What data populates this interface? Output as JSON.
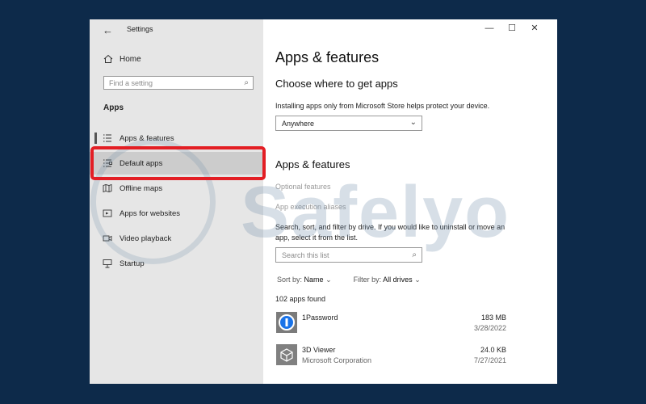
{
  "window": {
    "title": "Settings",
    "controls": {
      "minimize": "—",
      "maximize": "☐",
      "close": "✕"
    }
  },
  "sidebar": {
    "home_label": "Home",
    "search_placeholder": "Find a setting",
    "section_title": "Apps",
    "items": [
      {
        "label": "Apps & features",
        "icon": "list-icon"
      },
      {
        "label": "Default apps",
        "icon": "default-list-icon"
      },
      {
        "label": "Offline maps",
        "icon": "map-icon"
      },
      {
        "label": "Apps for websites",
        "icon": "web-app-icon"
      },
      {
        "label": "Video playback",
        "icon": "video-icon"
      },
      {
        "label": "Startup",
        "icon": "startup-icon"
      }
    ]
  },
  "main": {
    "page_title": "Apps & features",
    "choose_heading": "Choose where to get apps",
    "choose_desc": "Installing apps only from Microsoft Store helps protect your device.",
    "source_selected": "Anywhere",
    "section_heading": "Apps & features",
    "optional_features": "Optional features",
    "execution_aliases": "App execution aliases",
    "search_desc_line1": "Search, sort, and filter by drive. If you would like to uninstall or move an",
    "search_desc_line2": "app, select it from the list.",
    "list_search_placeholder": "Search this list",
    "sort_label": "Sort by:",
    "sort_value": "Name",
    "filter_label": "Filter by:",
    "filter_value": "All drives",
    "apps_found": "102 apps found",
    "apps": [
      {
        "name": "1Password",
        "publisher": "",
        "size": "183 MB",
        "date": "3/28/2022"
      },
      {
        "name": "3D Viewer",
        "publisher": "Microsoft Corporation",
        "size": "24.0 KB",
        "date": "7/27/2021"
      }
    ]
  },
  "watermark": {
    "text": "Safelyo"
  },
  "colors": {
    "highlight": "#e31e24",
    "background": "#0d2a4a",
    "sidebar": "#e6e6e6"
  }
}
